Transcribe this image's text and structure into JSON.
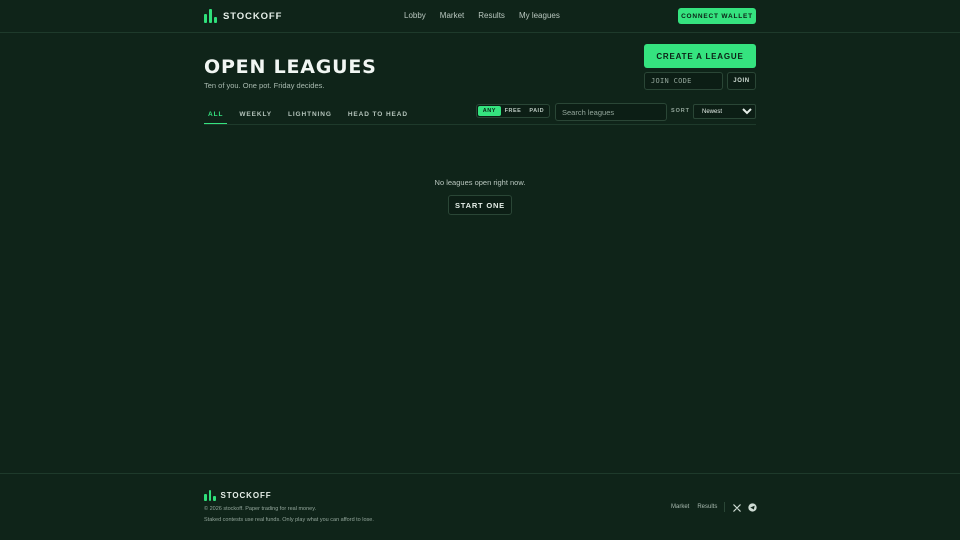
{
  "brand": {
    "name": "STOCKOFF"
  },
  "nav": {
    "items": [
      "Lobby",
      "Market",
      "Results",
      "My leagues"
    ]
  },
  "header": {
    "connect_label": "CONNECT WALLET"
  },
  "hero": {
    "title": "OPEN LEAGUES",
    "subtitle": "Ten of you. One pot. Friday decides.",
    "create_label": "CREATE A LEAGUE",
    "join_placeholder": "JOIN CODE",
    "join_label": "JOIN"
  },
  "tabs": [
    {
      "label": "ALL",
      "active": true
    },
    {
      "label": "WEEKLY",
      "active": false
    },
    {
      "label": "LIGHTNING",
      "active": false
    },
    {
      "label": "HEAD TO HEAD",
      "active": false
    }
  ],
  "filters": {
    "price": [
      "ANY",
      "FREE",
      "PAID"
    ],
    "price_selected": "ANY",
    "search_placeholder": "Search leagues",
    "sort_label": "SORT",
    "sort_selected": "Newest"
  },
  "empty": {
    "message": "No leagues open right now.",
    "cta_label": "START ONE"
  },
  "footer": {
    "brand": "STOCKOFF",
    "copyright": "© 2026 stockoff. Paper trading for real money.",
    "disclaimer": "Staked contests use real funds. Only play what you can afford to lose.",
    "links": [
      "Market",
      "Results"
    ]
  },
  "colors": {
    "background": "#0f2419",
    "accent": "#35e37f",
    "border": "#2a4636"
  },
  "icons": {
    "brand": "bar-chart-icon",
    "social": [
      "x-icon",
      "telegram-icon"
    ]
  }
}
